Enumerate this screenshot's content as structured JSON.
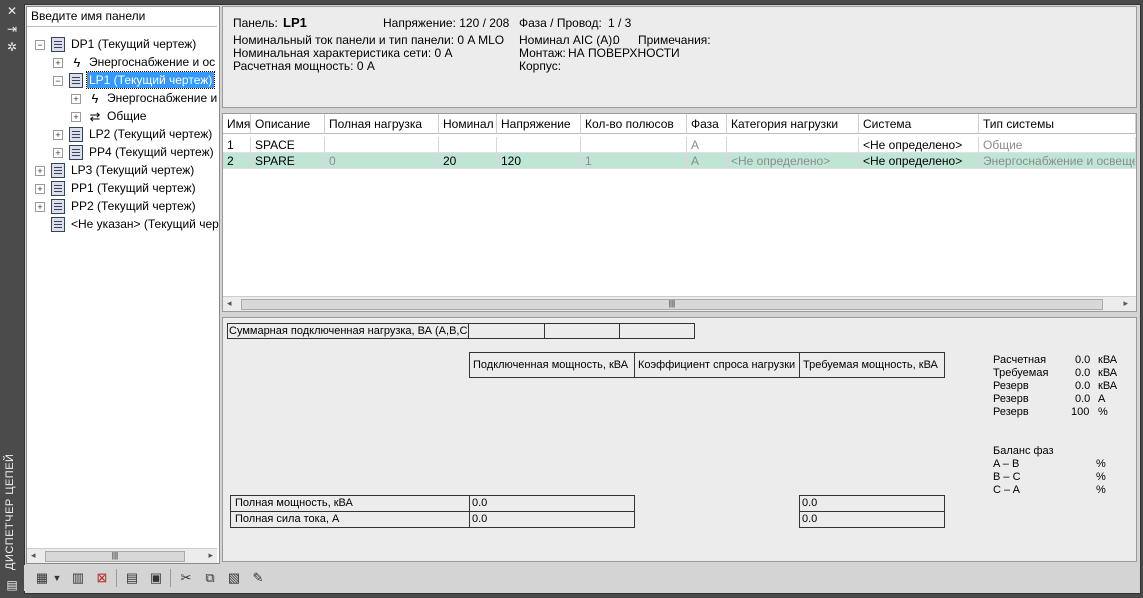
{
  "palette": {
    "title": "ДИСПЕТЧЕР ЦЕПЕЙ"
  },
  "tree": {
    "search_placeholder": "Введите имя панели",
    "nodes": [
      {
        "label": "DP1 (Текущий чертеж)",
        "icon": "panel-icon"
      },
      {
        "label": "Энергоснабжение и ос",
        "icon": "power-icon"
      },
      {
        "label": "LP1 (Текущий чертеж)",
        "icon": "panel-icon"
      },
      {
        "label": "Энергоснабжение и",
        "icon": "power-icon"
      },
      {
        "label": "Общие",
        "icon": "general-icon"
      },
      {
        "label": "LP2 (Текущий чертеж)",
        "icon": "panel-icon"
      },
      {
        "label": "PP4 (Текущий чертеж)",
        "icon": "panel-icon"
      },
      {
        "label": "LP3 (Текущий чертеж)",
        "icon": "panel-icon"
      },
      {
        "label": "PP1 (Текущий чертеж)",
        "icon": "panel-icon"
      },
      {
        "label": "PP2 (Текущий чертеж)",
        "icon": "panel-icon"
      },
      {
        "label": "<Не указан> (Текущий чер",
        "icon": "panel-icon"
      }
    ]
  },
  "info": {
    "panel_label": "Панель:",
    "panel_value": "LP1",
    "voltage": "Напряжение: 120 / 208",
    "phase_wire_label": "Фаза / Провод:",
    "phase_wire_value": "1 /  3",
    "nominal_current": "Номинальный ток панели и тип панели: 0 A MLO",
    "aic_label": "Номинал AIC (A):",
    "aic_value": "0",
    "notes_label": "Примечания:",
    "network_rating": "Номинальная характеристика сети: 0 A",
    "mount_label": "Монтаж:",
    "mount_value": "НА ПОВЕРХНОСТИ",
    "design_power": "Расчетная мощность: 0 A",
    "housing_label": "Корпус:"
  },
  "grid": {
    "columns": [
      "Имя",
      "Описание",
      "Полная нагрузка",
      "Номинал",
      "Напряжение",
      "Кол-во полюсов",
      "Фаза",
      "Категория нагрузки",
      "Система",
      "Тип системы"
    ],
    "rows": [
      {
        "name": "1",
        "desc": "SPACE",
        "load": "",
        "rating": "",
        "voltage": "",
        "poles": "",
        "phase": "A",
        "category": "",
        "system": "<Не определено>",
        "system_type": "Общие"
      },
      {
        "name": "2",
        "desc": "SPARE",
        "load": "0",
        "rating": "20",
        "voltage": "120",
        "poles": "1",
        "phase": "A",
        "category": "<Не определено>",
        "system": "<Не определено>",
        "system_type": "Энергоснабжение и освеще"
      }
    ]
  },
  "summary": {
    "connected_load_label": "Суммарная подключенная нагрузка, ВА (A,B,C)",
    "headers": [
      "Подключенная мощность, кВА",
      "Коэффициент спроса нагрузки",
      "Требуемая мощность, кВА"
    ],
    "total_kva_label": "Полная мощность, кВА",
    "total_current_label": "Полная сила тока, А",
    "total_kva_value": "0.0",
    "total_current_value": "0.0",
    "required_kva_value": "0.0",
    "required_current_value": "0.0",
    "stats": [
      {
        "label": "Расчетная",
        "value": "0.0",
        "unit": "кВА"
      },
      {
        "label": "Требуемая",
        "value": "0.0",
        "unit": "кВА"
      },
      {
        "label": "Резерв",
        "value": "0.0",
        "unit": "кВА"
      },
      {
        "label": "Резерв",
        "value": "0.0",
        "unit": "A"
      },
      {
        "label": "Резерв",
        "value": "100",
        "unit": "%"
      }
    ],
    "balance_title": "Баланс фаз",
    "balance": [
      {
        "label": "A – B",
        "unit": "%"
      },
      {
        "label": "B – C",
        "unit": "%"
      },
      {
        "label": "C – A",
        "unit": "%"
      }
    ]
  }
}
